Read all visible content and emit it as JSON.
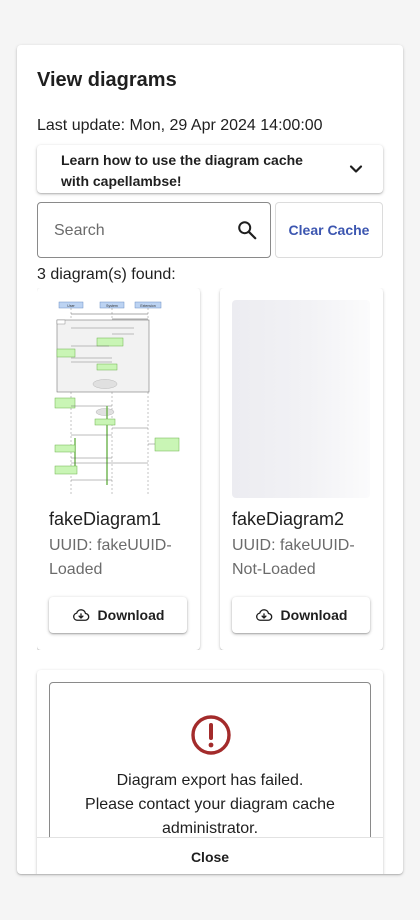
{
  "dialog": {
    "title": "View diagrams",
    "last_update": "Last update: Mon, 29 Apr 2024 14:00:00"
  },
  "accordion": {
    "label": "Learn how to use the diagram cache with capellambse!",
    "icon": "chevron-down-icon"
  },
  "search": {
    "placeholder": "Search",
    "value": "",
    "icon": "search-icon"
  },
  "clear_cache_label": "Clear Cache",
  "found_text": "3 diagram(s) found:",
  "diagrams": [
    {
      "name": "fakeDiagram1",
      "uuid": "UUID: fakeUUID-Loaded",
      "download_label": "Download",
      "preview": {
        "lifelines": [
          "User",
          "System",
          "Extension"
        ]
      }
    },
    {
      "name": "fakeDiagram2",
      "uuid": "UUID: fakeUUID-Not-Loaded",
      "download_label": "Download"
    }
  ],
  "error": {
    "icon": "error-icon",
    "line1": "Diagram export has failed.",
    "line2": "Please contact your diagram cache",
    "line3": "administrator.",
    "icon_color": "#a32b2b"
  },
  "close_label": "Close",
  "colors": {
    "accent": "#3c56b0",
    "error": "#a32b2b"
  }
}
